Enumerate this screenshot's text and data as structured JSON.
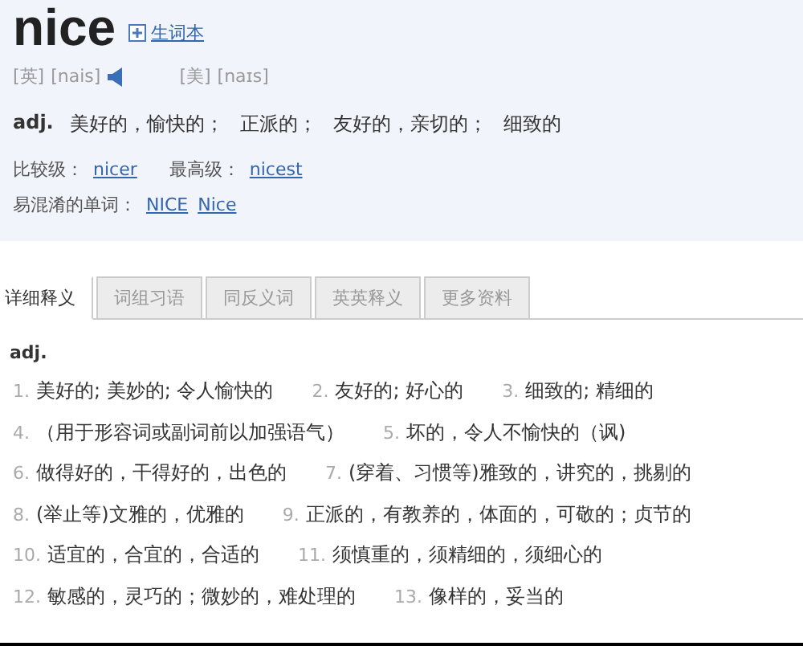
{
  "header": {
    "word": "nice",
    "wordbook_link": "生词本"
  },
  "pronunciations": [
    {
      "region": "[英]",
      "phonetic": "[nais]",
      "has_audio": true
    },
    {
      "region": "[美]",
      "phonetic": "[naɪs]",
      "has_audio": false
    }
  ],
  "summary": {
    "pos": "adj.",
    "meanings": [
      "美好的，愉快的；",
      "正派的；",
      "友好的，亲切的；",
      "细致的"
    ]
  },
  "inflections": [
    {
      "label": "比较级：",
      "links": [
        "nicer"
      ]
    },
    {
      "label": "最高级：",
      "links": [
        "nicest"
      ]
    }
  ],
  "confusables": {
    "label": "易混淆的单词：",
    "links": [
      "NICE",
      "Nice"
    ]
  },
  "tabs": [
    {
      "label": "详细释义",
      "selected": true
    },
    {
      "label": "词组习语",
      "selected": false
    },
    {
      "label": "同反义词",
      "selected": false
    },
    {
      "label": "英英释义",
      "selected": false
    },
    {
      "label": "更多资料",
      "selected": false
    }
  ],
  "detail": {
    "pos": "adj.",
    "rows": [
      {
        "items": [
          {
            "number": "1.",
            "text": "美好的; 美妙的; 令人愉快的"
          },
          {
            "number": "2.",
            "text": "友好的; 好心的"
          },
          {
            "number": "3.",
            "text": "细致的; 精细的"
          }
        ]
      },
      {
        "items": [
          {
            "number": "4.",
            "text": "（用于形容词或副词前以加强语气）"
          },
          {
            "number": "5.",
            "text": "坏的，令人不愉快的（讽)"
          }
        ]
      },
      {
        "items": [
          {
            "number": "6.",
            "text": "做得好的，干得好的，出色的"
          },
          {
            "number": "7.",
            "text": "(穿着、习惯等)雅致的，讲究的，挑剔的"
          }
        ]
      },
      {
        "items": [
          {
            "number": "8.",
            "text": "(举止等)文雅的，优雅的"
          },
          {
            "number": "9.",
            "text": "正派的，有教养的，体面的，可敬的；贞节的"
          }
        ]
      },
      {
        "items": [
          {
            "number": "10.",
            "text": "适宜的，合宜的，合适的"
          },
          {
            "number": "11.",
            "text": "须慎重的，须精细的，须细心的"
          }
        ]
      },
      {
        "items": [
          {
            "number": "12.",
            "text": "敏感的，灵巧的；微妙的，难处理的"
          },
          {
            "number": "13.",
            "text": "像样的，妥当的"
          }
        ]
      }
    ]
  }
}
